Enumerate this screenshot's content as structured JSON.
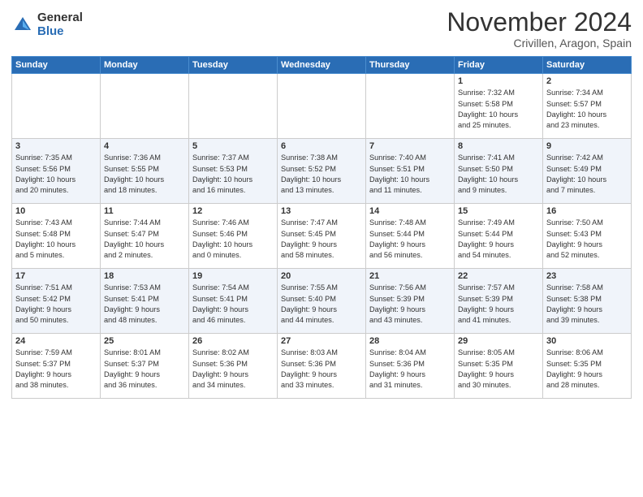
{
  "header": {
    "logo_general": "General",
    "logo_blue": "Blue",
    "month_title": "November 2024",
    "subtitle": "Crivillen, Aragon, Spain"
  },
  "weekdays": [
    "Sunday",
    "Monday",
    "Tuesday",
    "Wednesday",
    "Thursday",
    "Friday",
    "Saturday"
  ],
  "weeks": [
    [
      {
        "day": "",
        "info": ""
      },
      {
        "day": "",
        "info": ""
      },
      {
        "day": "",
        "info": ""
      },
      {
        "day": "",
        "info": ""
      },
      {
        "day": "",
        "info": ""
      },
      {
        "day": "1",
        "info": "Sunrise: 7:32 AM\nSunset: 5:58 PM\nDaylight: 10 hours\nand 25 minutes."
      },
      {
        "day": "2",
        "info": "Sunrise: 7:34 AM\nSunset: 5:57 PM\nDaylight: 10 hours\nand 23 minutes."
      }
    ],
    [
      {
        "day": "3",
        "info": "Sunrise: 7:35 AM\nSunset: 5:56 PM\nDaylight: 10 hours\nand 20 minutes."
      },
      {
        "day": "4",
        "info": "Sunrise: 7:36 AM\nSunset: 5:55 PM\nDaylight: 10 hours\nand 18 minutes."
      },
      {
        "day": "5",
        "info": "Sunrise: 7:37 AM\nSunset: 5:53 PM\nDaylight: 10 hours\nand 16 minutes."
      },
      {
        "day": "6",
        "info": "Sunrise: 7:38 AM\nSunset: 5:52 PM\nDaylight: 10 hours\nand 13 minutes."
      },
      {
        "day": "7",
        "info": "Sunrise: 7:40 AM\nSunset: 5:51 PM\nDaylight: 10 hours\nand 11 minutes."
      },
      {
        "day": "8",
        "info": "Sunrise: 7:41 AM\nSunset: 5:50 PM\nDaylight: 10 hours\nand 9 minutes."
      },
      {
        "day": "9",
        "info": "Sunrise: 7:42 AM\nSunset: 5:49 PM\nDaylight: 10 hours\nand 7 minutes."
      }
    ],
    [
      {
        "day": "10",
        "info": "Sunrise: 7:43 AM\nSunset: 5:48 PM\nDaylight: 10 hours\nand 5 minutes."
      },
      {
        "day": "11",
        "info": "Sunrise: 7:44 AM\nSunset: 5:47 PM\nDaylight: 10 hours\nand 2 minutes."
      },
      {
        "day": "12",
        "info": "Sunrise: 7:46 AM\nSunset: 5:46 PM\nDaylight: 10 hours\nand 0 minutes."
      },
      {
        "day": "13",
        "info": "Sunrise: 7:47 AM\nSunset: 5:45 PM\nDaylight: 9 hours\nand 58 minutes."
      },
      {
        "day": "14",
        "info": "Sunrise: 7:48 AM\nSunset: 5:44 PM\nDaylight: 9 hours\nand 56 minutes."
      },
      {
        "day": "15",
        "info": "Sunrise: 7:49 AM\nSunset: 5:44 PM\nDaylight: 9 hours\nand 54 minutes."
      },
      {
        "day": "16",
        "info": "Sunrise: 7:50 AM\nSunset: 5:43 PM\nDaylight: 9 hours\nand 52 minutes."
      }
    ],
    [
      {
        "day": "17",
        "info": "Sunrise: 7:51 AM\nSunset: 5:42 PM\nDaylight: 9 hours\nand 50 minutes."
      },
      {
        "day": "18",
        "info": "Sunrise: 7:53 AM\nSunset: 5:41 PM\nDaylight: 9 hours\nand 48 minutes."
      },
      {
        "day": "19",
        "info": "Sunrise: 7:54 AM\nSunset: 5:41 PM\nDaylight: 9 hours\nand 46 minutes."
      },
      {
        "day": "20",
        "info": "Sunrise: 7:55 AM\nSunset: 5:40 PM\nDaylight: 9 hours\nand 44 minutes."
      },
      {
        "day": "21",
        "info": "Sunrise: 7:56 AM\nSunset: 5:39 PM\nDaylight: 9 hours\nand 43 minutes."
      },
      {
        "day": "22",
        "info": "Sunrise: 7:57 AM\nSunset: 5:39 PM\nDaylight: 9 hours\nand 41 minutes."
      },
      {
        "day": "23",
        "info": "Sunrise: 7:58 AM\nSunset: 5:38 PM\nDaylight: 9 hours\nand 39 minutes."
      }
    ],
    [
      {
        "day": "24",
        "info": "Sunrise: 7:59 AM\nSunset: 5:37 PM\nDaylight: 9 hours\nand 38 minutes."
      },
      {
        "day": "25",
        "info": "Sunrise: 8:01 AM\nSunset: 5:37 PM\nDaylight: 9 hours\nand 36 minutes."
      },
      {
        "day": "26",
        "info": "Sunrise: 8:02 AM\nSunset: 5:36 PM\nDaylight: 9 hours\nand 34 minutes."
      },
      {
        "day": "27",
        "info": "Sunrise: 8:03 AM\nSunset: 5:36 PM\nDaylight: 9 hours\nand 33 minutes."
      },
      {
        "day": "28",
        "info": "Sunrise: 8:04 AM\nSunset: 5:36 PM\nDaylight: 9 hours\nand 31 minutes."
      },
      {
        "day": "29",
        "info": "Sunrise: 8:05 AM\nSunset: 5:35 PM\nDaylight: 9 hours\nand 30 minutes."
      },
      {
        "day": "30",
        "info": "Sunrise: 8:06 AM\nSunset: 5:35 PM\nDaylight: 9 hours\nand 28 minutes."
      }
    ]
  ]
}
